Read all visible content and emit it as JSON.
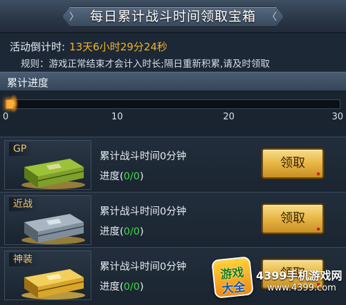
{
  "header": {
    "title": "每日累计战斗时间领取宝箱"
  },
  "info": {
    "countdown_label": "活动倒计时:",
    "countdown_value": "13天6小时29分24秒",
    "rules": "规则：游戏正常结束才会计入时长;隔日重新积累,请及时领取"
  },
  "progress": {
    "label": "累计进度",
    "ticks": [
      "0",
      "10",
      "20",
      "30"
    ],
    "current": 0,
    "max": 30
  },
  "rewards": [
    {
      "tier": "GP",
      "description": "累计战斗时间0分钟",
      "progress_label": "进度(",
      "progress_value": "0/0",
      "progress_close": ")",
      "button_label": "领取",
      "chest_color": "#7fa02a",
      "chest_icon": "gp-chest-icon"
    },
    {
      "tier": "近战",
      "description": "累计战斗时间0分钟",
      "progress_label": "进度(",
      "progress_value": "0/0",
      "progress_close": ")",
      "button_label": "领取",
      "chest_color": "#7f8e9c",
      "chest_icon": "melee-chest-icon"
    },
    {
      "tier": "神装",
      "description": "累计战斗时间0分钟",
      "progress_label": "进度(",
      "progress_value": "0/0",
      "progress_close": ")",
      "button_label": "领取",
      "chest_color": "#d8a62a",
      "chest_icon": "divine-chest-icon"
    }
  ],
  "watermark": {
    "badge_top": "游戏",
    "badge_bottom": "大全",
    "title": "4399手机游戏网",
    "url": "www.4399.com"
  },
  "colors": {
    "accent_gold": "#f2b428",
    "progress_green": "#45d94d",
    "button_gold": "#e9ba4a"
  }
}
